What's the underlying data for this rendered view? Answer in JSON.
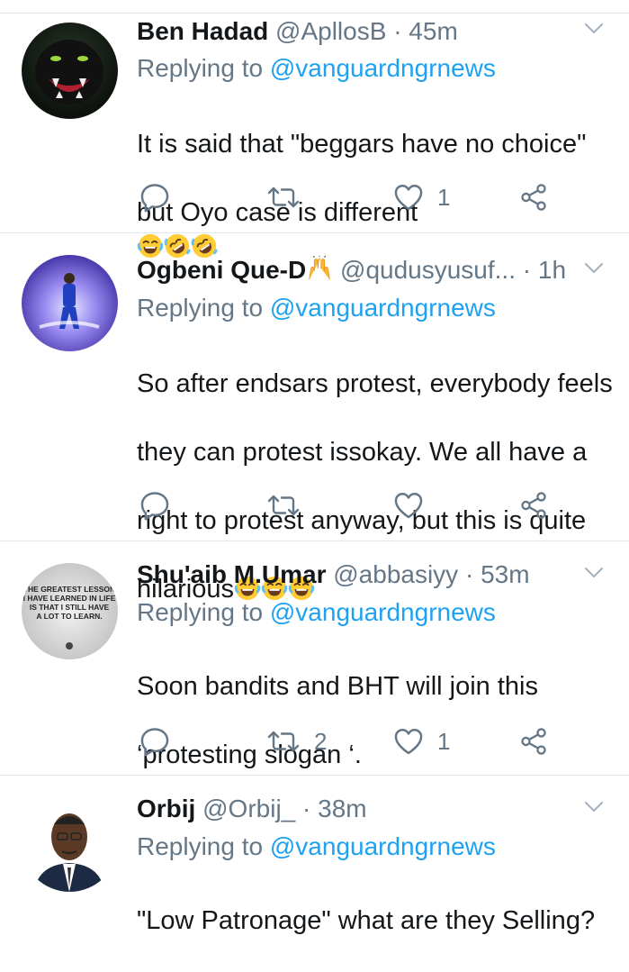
{
  "replying_label": "Replying to",
  "tweets": [
    {
      "name": "Ben Hadad",
      "handle": "@ApllosB",
      "sep": "·",
      "time": "45m",
      "reply_to": "@vanguardngrnews",
      "lines": [
        "It is said that \"beggars have no choice\"",
        "but Oyo case is different"
      ],
      "reply_count": "",
      "retweet_count": "",
      "like_count": "1"
    },
    {
      "name": "Ogbeni Que-D",
      "handle": "@qudusyusuf...",
      "sep": "·",
      "time": "1h",
      "reply_to": "@vanguardngrnews",
      "lines": [
        "So after endsars protest, everybody feels",
        "they can protest issokay.  We all have a",
        "right to protest anyway, but this is quite",
        "hilarious"
      ],
      "reply_count": "",
      "retweet_count": "",
      "like_count": ""
    },
    {
      "name": "Shu'aib M.Umar",
      "handle": "@abbasiyy",
      "sep": "·",
      "time": "53m",
      "reply_to": "@vanguardngrnews",
      "lines": [
        "Soon bandits and BHT will join this",
        "‘protesting slogan ‘."
      ],
      "avatar_text": [
        "THE GREATEST LESSON",
        "I HAVE LEARNED IN LIFE",
        "IS THAT I STILL HAVE",
        "A LOT TO LEARN."
      ],
      "reply_count": "",
      "retweet_count": "2",
      "like_count": "1"
    },
    {
      "name": "Orbij",
      "handle": "@Orbij_",
      "sep": "·",
      "time": "38m",
      "reply_to": "@vanguardngrnews",
      "lines": [
        "\"Low Patronage\" what are they Selling?"
      ],
      "reply_count": "",
      "retweet_count": "",
      "like_count": ""
    }
  ],
  "colors": {
    "text": "#14171a",
    "muted": "#657786",
    "link": "#1da1f2",
    "divider": "#e1e8ed"
  }
}
